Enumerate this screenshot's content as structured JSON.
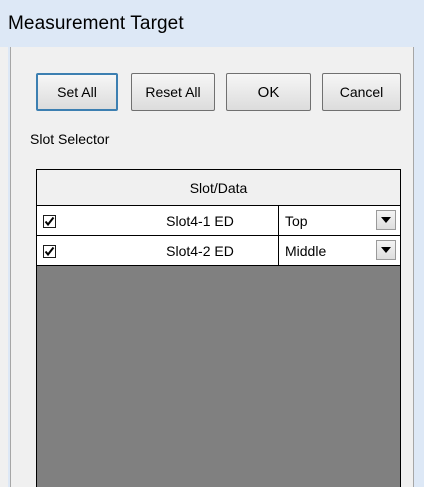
{
  "window": {
    "title": "Measurement Target"
  },
  "toolbar": {
    "set_all_label": "Set All",
    "reset_all_label": "Reset All",
    "ok_label": "OK",
    "cancel_label": "Cancel"
  },
  "slot_selector": {
    "label": "Slot Selector",
    "column_header": "Slot/Data",
    "rows": [
      {
        "checked": true,
        "name": "Slot4-1 ED",
        "position": "Top"
      },
      {
        "checked": true,
        "name": "Slot4-2 ED",
        "position": "Middle"
      }
    ]
  },
  "icons": {
    "checkbox": "checkmark-icon",
    "dropdown": "chevron-down-icon"
  }
}
